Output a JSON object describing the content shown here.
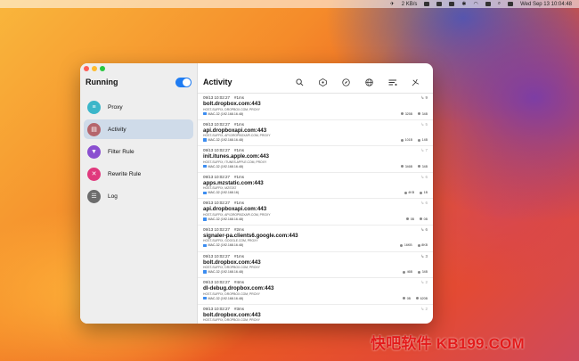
{
  "menubar": {
    "network_speed": "2 KB/s",
    "datetime": "Wed Sep 13  10:04:48"
  },
  "window": {
    "app_title": "Running",
    "content_title": "Activity"
  },
  "sidebar": {
    "items": [
      {
        "label": "Proxy",
        "icon": "list-icon",
        "color": "#3bb6c9"
      },
      {
        "label": "Activity",
        "icon": "clipboard-icon",
        "color": "#b5656c",
        "active": true
      },
      {
        "label": "Filter Rule",
        "icon": "filter-icon",
        "color": "#8a4fd0"
      },
      {
        "label": "Rewrite Rule",
        "icon": "xmark-icon",
        "color": "#e0397d"
      },
      {
        "label": "Log",
        "icon": "lines-icon",
        "color": "#6c6c6c"
      }
    ]
  },
  "toolbar": {
    "icons": [
      "search-icon",
      "tag-icon",
      "compass-icon",
      "globe-icon",
      "filter-lines-icon",
      "plane-icon"
    ]
  },
  "activity": [
    {
      "time": "09/13 10:02:27",
      "dur": "#1ms",
      "count": "9",
      "host": "bolt.dropbox.com:443",
      "rule": "HOST-SUFFIX, DROPBOX.COM, PROXY",
      "src": "MAC-32 (192.168.16.48)",
      "down": "325B",
      "up": "34B"
    },
    {
      "time": "09/13 10:02:27",
      "dur": "#1ms",
      "count": "5",
      "host": "api.dropboxapi.com:443",
      "rule": "HOST-SUFFIX, API.DROPBOXAPI.COM, PROXY",
      "src": "MAC-32 (192.168.16.48)",
      "down": "101B",
      "up": "14B"
    },
    {
      "time": "09/13 10:02:27",
      "dur": "#1ms",
      "count": "7",
      "host": "init.itunes.apple.com:443",
      "rule": "HOST-SUFFIX, ITUNES.APPLE.COM, PROXY",
      "src": "MAC-32 (192.168.16.48)",
      "down": "346B",
      "up": "34B"
    },
    {
      "time": "09/13 10:02:27",
      "dur": "#1ms",
      "count": "6",
      "host": "apps.mzstatic.com:443",
      "rule": "HOST-SUFFIX, MZSTAT",
      "src": "MAC-32 (192.168.16)",
      "down": "4KB",
      "up": "1B"
    },
    {
      "time": "09/13 10:02:27",
      "dur": "#1ms",
      "count": "6",
      "host": "api.dropboxapi.com:443",
      "rule": "HOST-SUFFIX, API.DROPBOXAPI.COM, PROXY",
      "src": "MAC-32 (192.168.16.48)",
      "down": "0B",
      "up": "0B"
    },
    {
      "time": "09/13 10:02:27",
      "dur": "#2ms",
      "count": "6",
      "host": "signaler-pa.clients6.google.com:443",
      "rule": "HOST-SUFFIX, GOOGLE.COM, PROXY",
      "src": "MAC-32 (192.168.16.48)",
      "down": "16KB",
      "up": "8KB"
    },
    {
      "time": "09/13 10:02:27",
      "dur": "#1ms",
      "count": "3",
      "host": "bolt.dropbox.com:443",
      "rule": "HOST-SUFFIX, DROPBOX.COM, PROXY",
      "src": "MAC-32 (192.168.16.48)",
      "down": "46B",
      "up": "34B"
    },
    {
      "time": "09/13 10:02:27",
      "dur": "#4ms",
      "count": "2",
      "host": "dl-debug.dropbox.com:443",
      "rule": "HOST-SUFFIX, DROPBOX.COM, PROXY",
      "src": "MAC-32 (192.168.16.48)",
      "down": "0B",
      "up": "620B"
    },
    {
      "time": "09/13 10:02:27",
      "dur": "#3ms",
      "count": "2",
      "host": "bolt.dropbox.com:443",
      "rule": "HOST-SUFFIX, DROPBOX.COM, PROXY",
      "src": "",
      "down": "",
      "up": ""
    }
  ],
  "watermark": "快吧软件 KB199.COM"
}
